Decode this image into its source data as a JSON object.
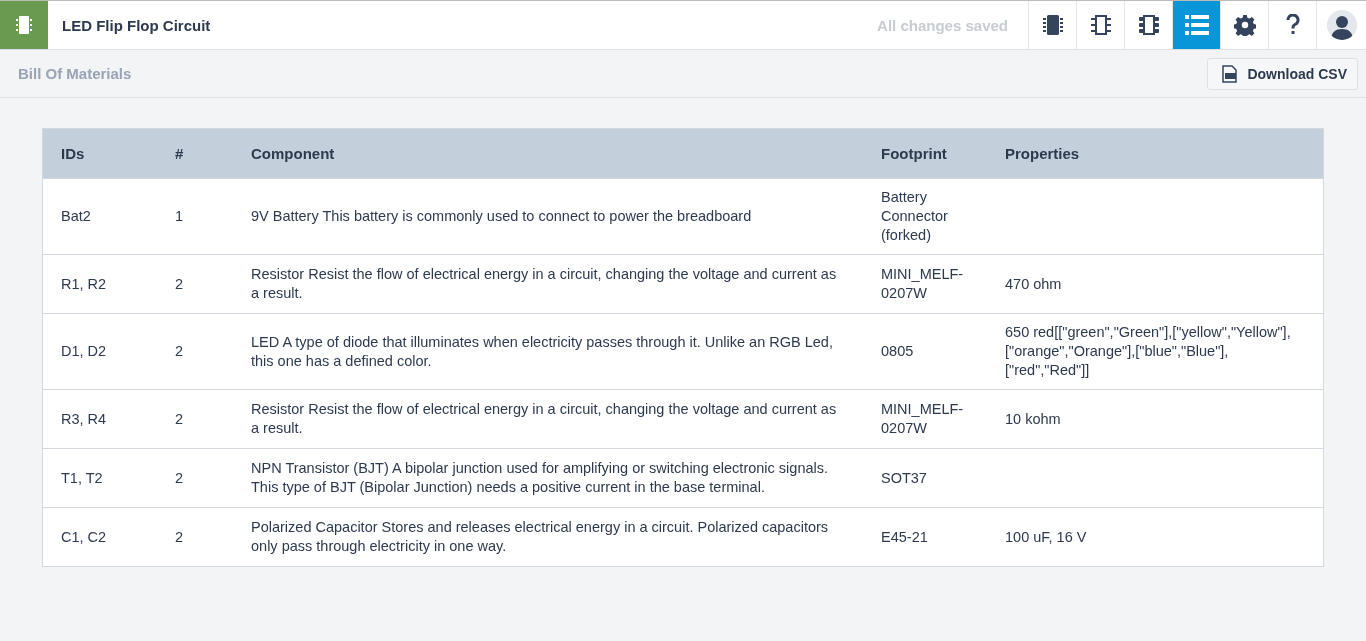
{
  "header": {
    "title": "LED Flip Flop Circuit",
    "save_status": "All changes saved",
    "views": [
      {
        "kind": "chip",
        "selected": false
      },
      {
        "kind": "schematic",
        "selected": false
      },
      {
        "kind": "pcb",
        "selected": false
      },
      {
        "kind": "bom",
        "selected": true
      }
    ]
  },
  "toolbar": {
    "title": "Bill Of Materials",
    "download_button": "Download CSV"
  },
  "table": {
    "columns": [
      "IDs",
      "#",
      "Component",
      "Footprint",
      "Properties"
    ],
    "rows": [
      [
        "Bat2",
        "1",
        "9V Battery This battery is commonly used to connect to power the breadboard",
        "Battery Connector (forked)",
        ""
      ],
      [
        "R1, R2",
        "2",
        "Resistor Resist the flow of electrical energy in a circuit, changing the voltage and current as a result.",
        "MINI_MELF-0207W",
        "470 ohm"
      ],
      [
        "D1, D2",
        "2",
        "LED A type of diode that illuminates when electricity passes through it. Unlike an RGB Led, this one has a defined color.",
        "0805",
        "650 red[[\"green\",\"Green\"],[\"yellow\",\"Yellow\"],[\"orange\",\"Orange\"],[\"blue\",\"Blue\"],[\"red\",\"Red\"]]"
      ],
      [
        "R3, R4",
        "2",
        "Resistor Resist the flow of electrical energy in a circuit, changing the voltage and current as a result.",
        "MINI_MELF-0207W",
        "10 kohm"
      ],
      [
        "T1, T2",
        "2",
        "NPN Transistor (BJT) A bipolar junction used for amplifying or switching electronic signals. This type of BJT (Bipolar Junction) needs a positive current in the base terminal.",
        "SOT37",
        ""
      ],
      [
        "C1, C2",
        "2",
        "Polarized Capacitor Stores and releases electrical energy in a circuit. Polarized capacitors only pass through electricity in one way.",
        "E45-21",
        "100 uF, 16 V"
      ]
    ]
  }
}
